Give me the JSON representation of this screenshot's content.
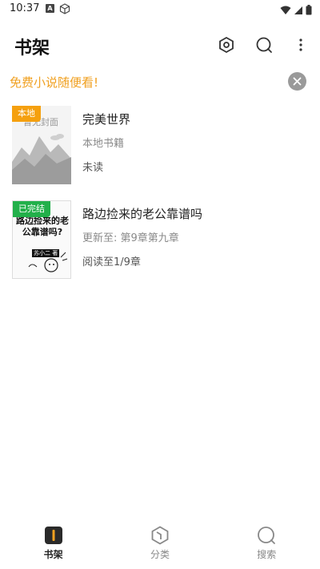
{
  "status_bar": {
    "time": "10:37",
    "notification_letter": "A"
  },
  "header": {
    "title": "书架"
  },
  "promo": {
    "text": "免费小说随便看!"
  },
  "books": [
    {
      "title": "完美世界",
      "subtitle": "本地书籍",
      "progress": "未读",
      "badge": "本地",
      "badge_color": "#f5a00f",
      "cover_text": "暂无封面"
    },
    {
      "title": "路边捡来的老公靠谱吗",
      "subtitle": "更新至: 第9章第九章",
      "progress": "阅读至1/9章",
      "badge": "已完结",
      "badge_color": "#22b04a",
      "cover_title": "路边捡来的老公靠谱吗?",
      "cover_author": "苏小二 著"
    }
  ],
  "bottom_nav": [
    {
      "label": "书架",
      "icon": "bookshelf-icon",
      "active": true
    },
    {
      "label": "分类",
      "icon": "category-icon",
      "active": false
    },
    {
      "label": "搜索",
      "icon": "search-icon",
      "active": false
    }
  ],
  "colors": {
    "accent": "#f0a020",
    "close_bg": "#9a9a9a",
    "finished_badge": "#22b04a",
    "local_badge": "#f5a00f"
  }
}
